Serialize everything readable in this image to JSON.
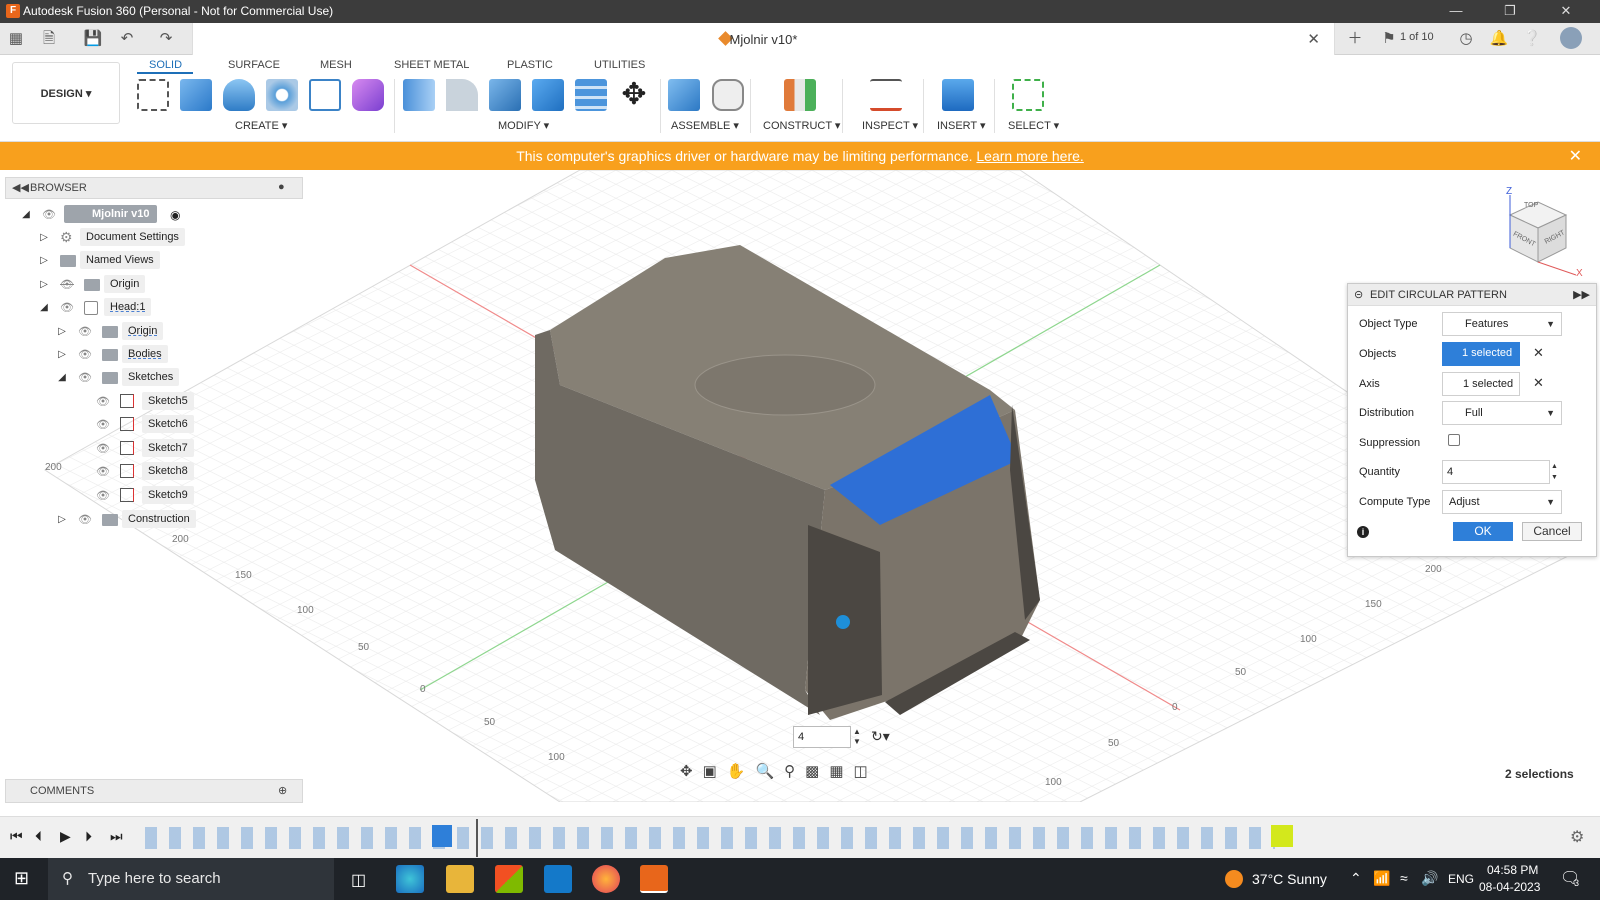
{
  "title_bar": {
    "title": "Autodesk Fusion 360 (Personal - Not for Commercial Use)",
    "app_letter": "F"
  },
  "doc_tab": {
    "name": "Mjolnir v10*",
    "page_counter": "1 of 10"
  },
  "ribbon": {
    "workspace": "DESIGN ▾",
    "tabs": [
      "SOLID",
      "SURFACE",
      "MESH",
      "SHEET METAL",
      "PLASTIC",
      "UTILITIES"
    ],
    "groups": [
      "CREATE ▾",
      "MODIFY ▾",
      "ASSEMBLE ▾",
      "CONSTRUCT ▾",
      "INSPECT ▾",
      "INSERT ▾",
      "SELECT ▾"
    ]
  },
  "warning": {
    "message": "This computer's graphics driver or hardware may be limiting performance.",
    "link": "Learn more here."
  },
  "browser": {
    "title": "BROWSER",
    "items": [
      {
        "label": "Mjolnir v10"
      },
      {
        "label": "Document Settings"
      },
      {
        "label": "Named Views"
      },
      {
        "label": "Origin"
      },
      {
        "label": "Head:1"
      },
      {
        "label": "Origin"
      },
      {
        "label": "Bodies"
      },
      {
        "label": "Sketches"
      },
      {
        "label": "Sketch5"
      },
      {
        "label": "Sketch6"
      },
      {
        "label": "Sketch7"
      },
      {
        "label": "Sketch8"
      },
      {
        "label": "Sketch9"
      },
      {
        "label": "Construction"
      }
    ]
  },
  "dialog": {
    "title": "EDIT CIRCULAR PATTERN",
    "object_type_label": "Object Type",
    "object_type_value": "Features",
    "objects_label": "Objects",
    "objects_value": "1 selected",
    "axis_label": "Axis",
    "axis_value": "1 selected",
    "distribution_label": "Distribution",
    "distribution_value": "Full",
    "suppression_label": "Suppression",
    "quantity_label": "Quantity",
    "quantity_value": "4",
    "compute_label": "Compute Type",
    "compute_value": "Adjust",
    "ok": "OK",
    "cancel": "Cancel"
  },
  "viewcube": {
    "top": "TOP",
    "front": "FRONT",
    "right": "RIGHT",
    "z": "Z",
    "x": "X"
  },
  "viewport": {
    "quantity_input": "4",
    "selections": "2 selections",
    "grid_labels": [
      "200",
      "200",
      "150",
      "100",
      "50",
      "0",
      "50",
      "100",
      "200",
      "150",
      "100",
      "50",
      "0",
      "50",
      "100"
    ]
  },
  "comments": {
    "title": "COMMENTS"
  },
  "taskbar": {
    "search_placeholder": "Type here to search",
    "weather": "37°C  Sunny",
    "lang": "ENG",
    "time": "04:58 PM",
    "date": "08-04-2023",
    "notifications": "3"
  },
  "colors": {
    "accent": "#1d6fb8",
    "warning": "#f8a01d",
    "selection": "#2e6fd6",
    "model": "#7b746a"
  }
}
